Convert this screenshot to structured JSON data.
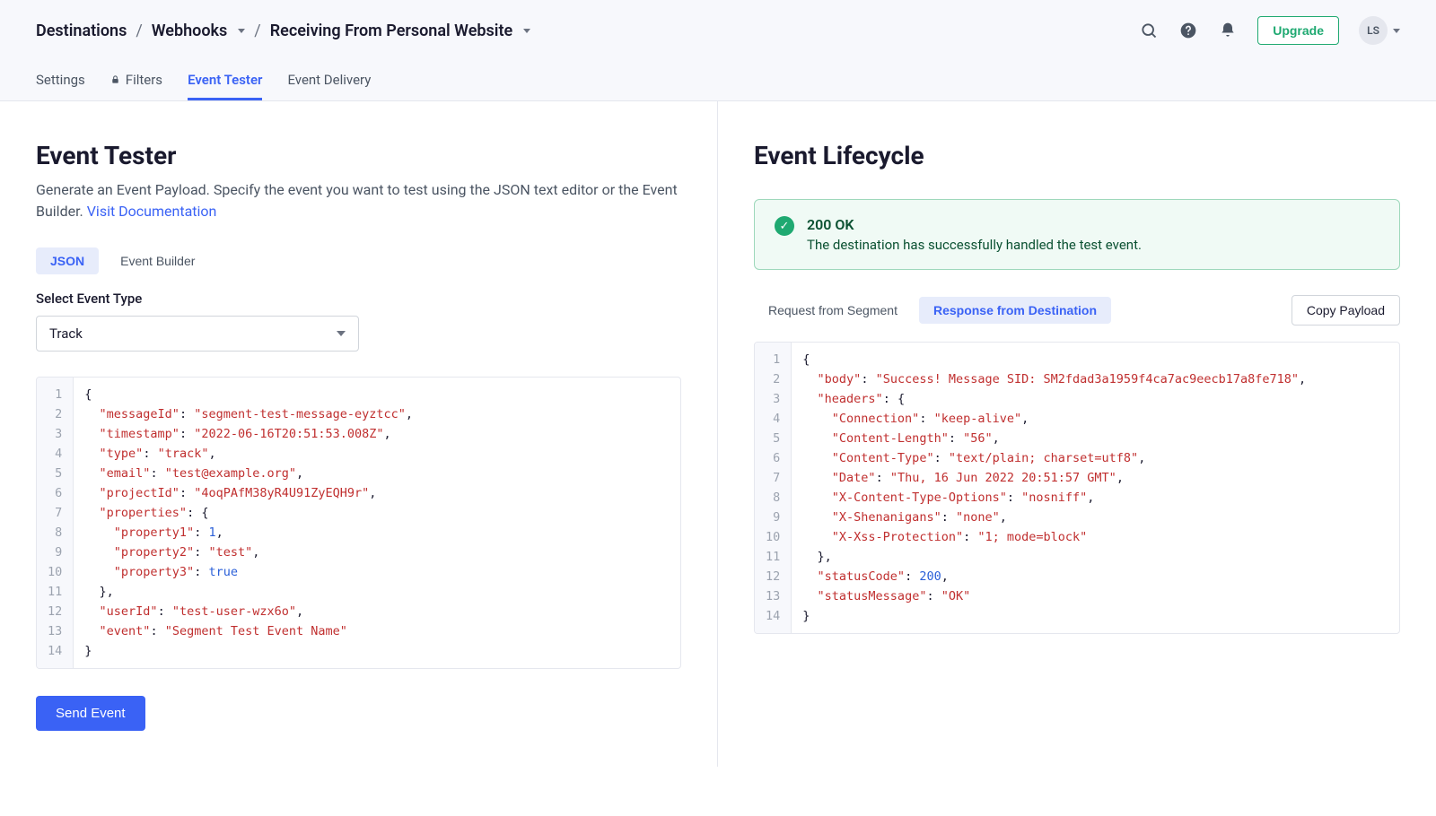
{
  "breadcrumb": {
    "root": "Destinations",
    "mid": "Webhooks",
    "leaf": "Receiving From Personal Website"
  },
  "header": {
    "upgrade": "Upgrade",
    "avatar_initials": "LS"
  },
  "subnav": {
    "settings": "Settings",
    "filters": "Filters",
    "tester": "Event Tester",
    "delivery": "Event Delivery"
  },
  "left": {
    "title": "Event Tester",
    "desc_a": "Generate an Event Payload. Specify the event you want to test using the JSON text editor or the Event Builder. ",
    "doc_link": "Visit Documentation",
    "tab_json": "JSON",
    "tab_builder": "Event Builder",
    "select_label": "Select Event Type",
    "select_value": "Track",
    "send_label": "Send Event",
    "payload": {
      "messageId": "segment-test-message-eyztcc",
      "timestamp": "2022-06-16T20:51:53.008Z",
      "type": "track",
      "email": "test@example.org",
      "projectId": "4oqPAfM38yR4U91ZyEQH9r",
      "properties": {
        "property1": 1,
        "property2": "test",
        "property3": true
      },
      "userId": "test-user-wzx6o",
      "event": "Segment Test Event Name"
    }
  },
  "right": {
    "title": "Event Lifecycle",
    "status_title": "200 OK",
    "status_msg": "The destination has successfully handled the test event.",
    "tab_req": "Request from Segment",
    "tab_res": "Response from Destination",
    "copy": "Copy Payload",
    "response": {
      "body": "Success! Message SID: SM2fdad3a1959f4ca7ac9eecb17a8fe718",
      "headers": {
        "Connection": "keep-alive",
        "Content-Length": "56",
        "Content-Type": "text/plain; charset=utf8",
        "Date": "Thu, 16 Jun 2022 20:51:57 GMT",
        "X-Content-Type-Options": "nosniff",
        "X-Shenanigans": "none",
        "X-Xss-Protection": "1; mode=block"
      },
      "statusCode": 200,
      "statusMessage": "OK"
    }
  }
}
